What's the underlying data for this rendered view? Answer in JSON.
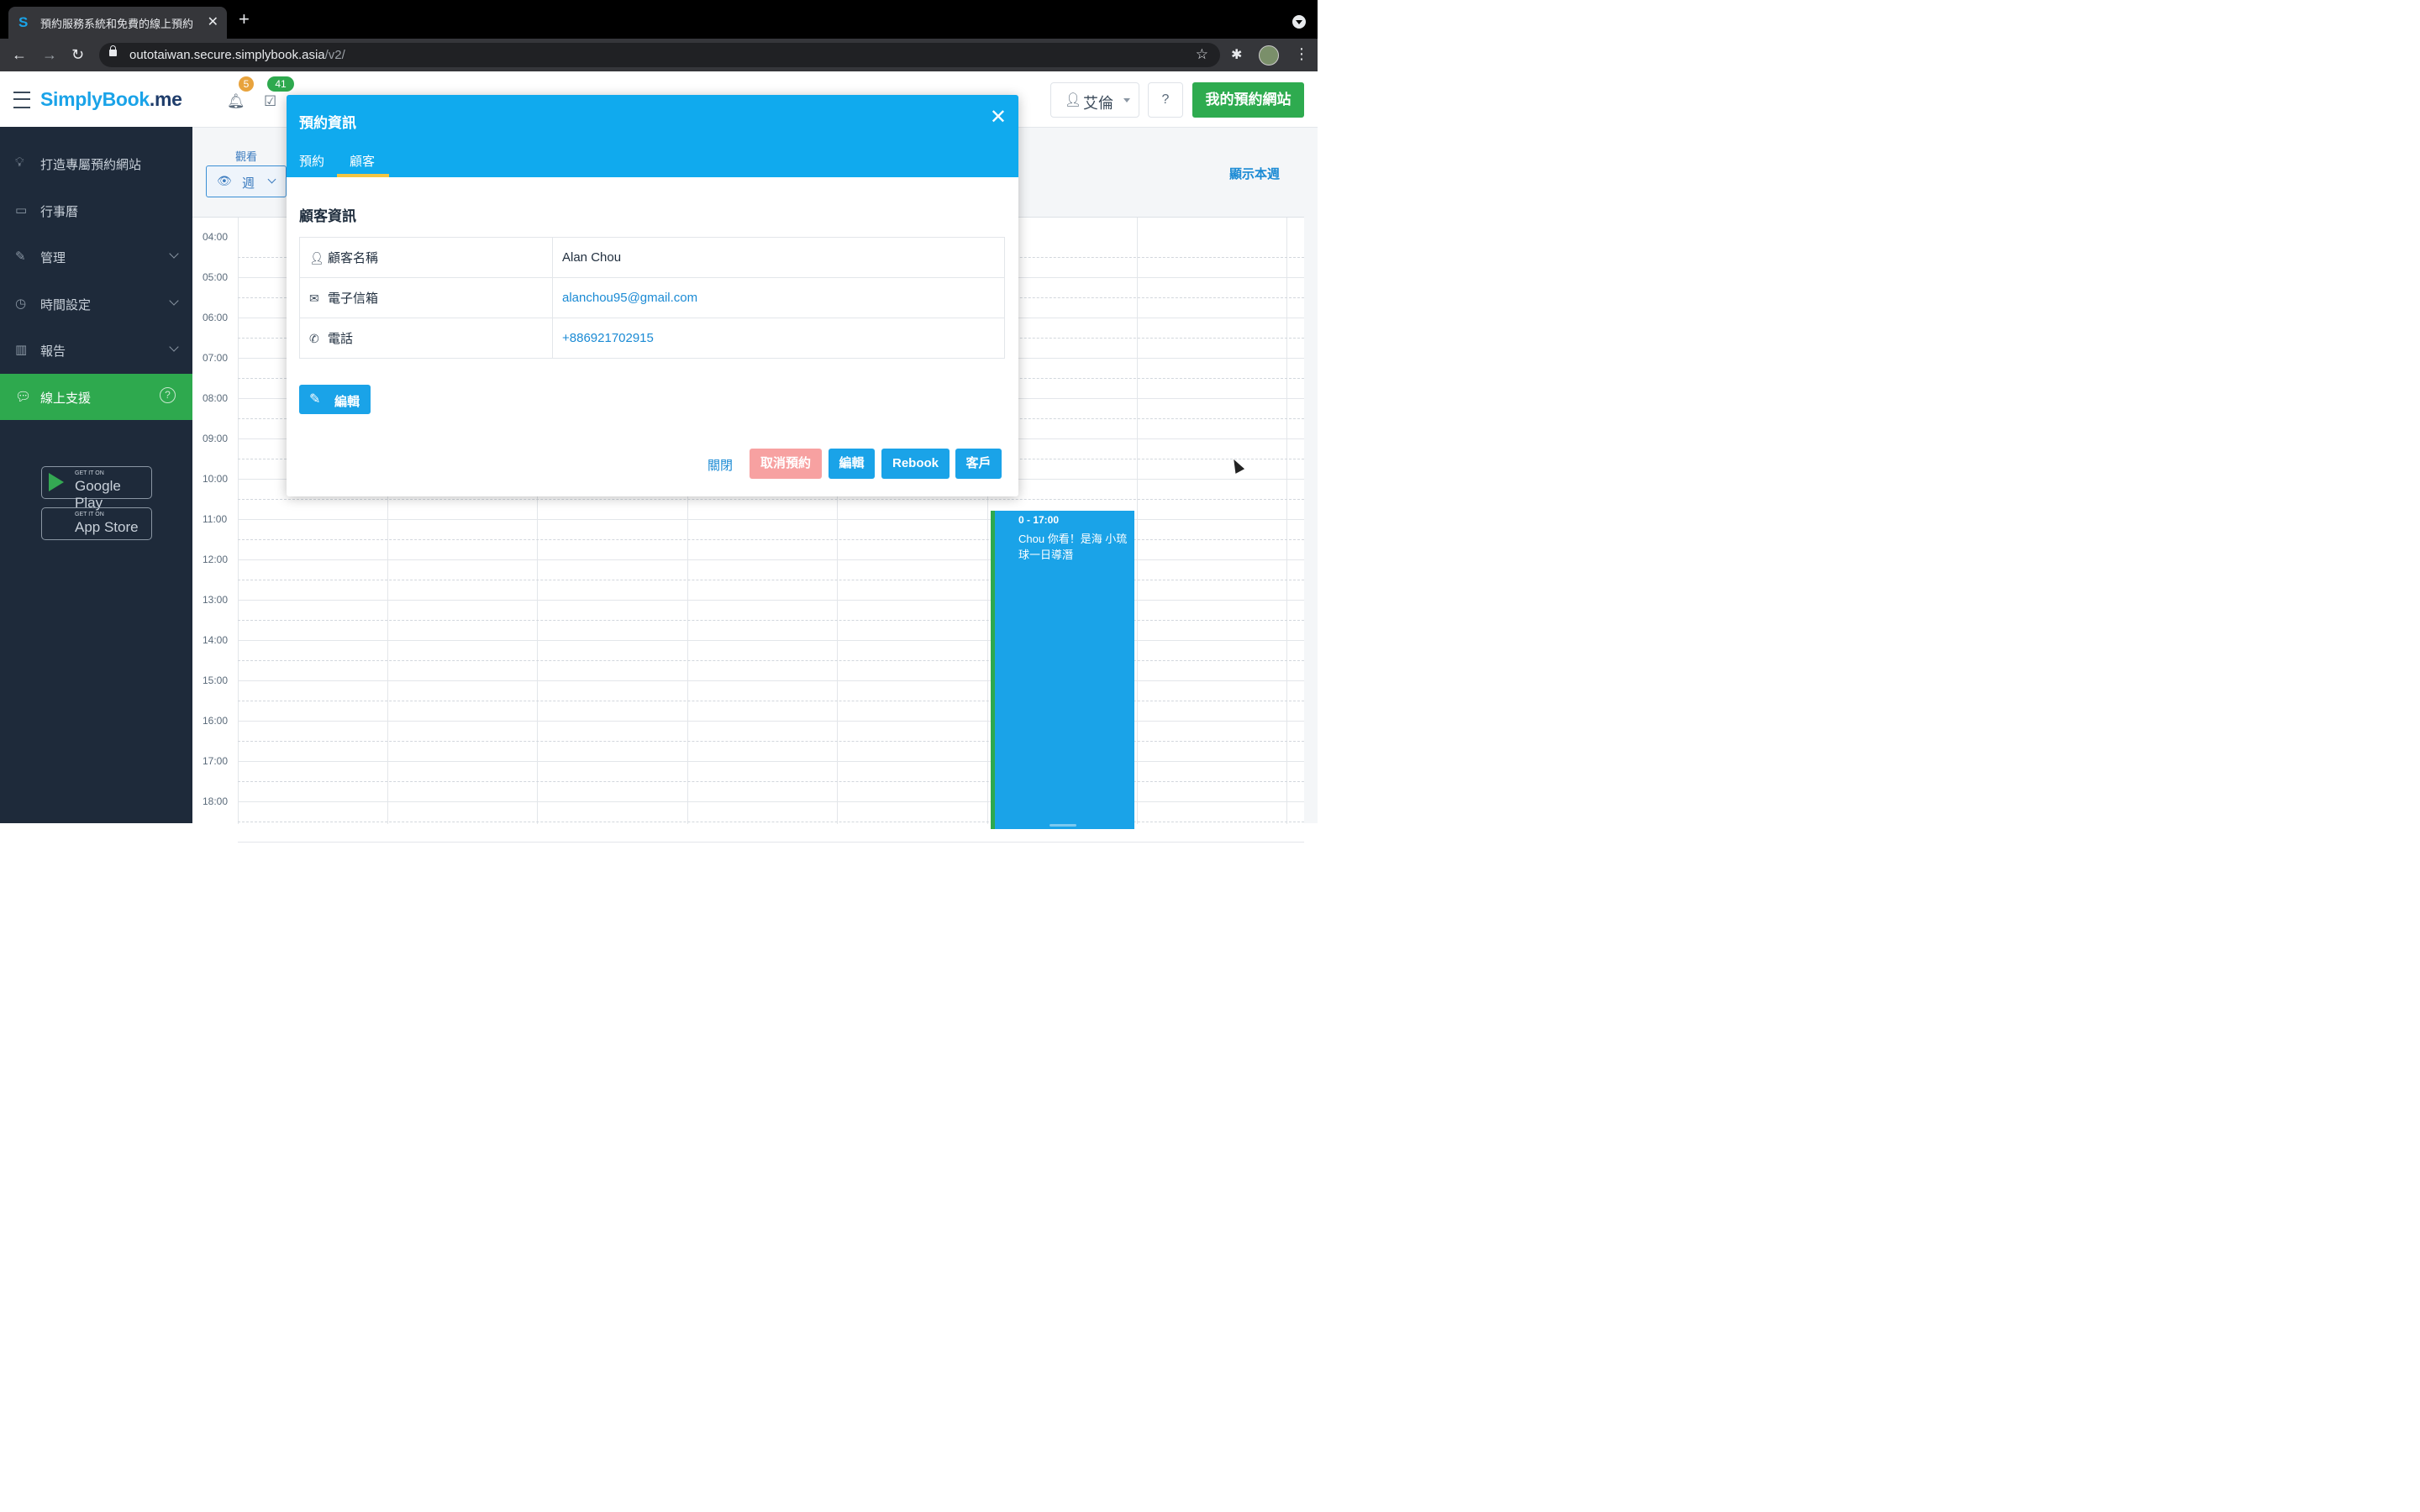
{
  "browser": {
    "tab_title": "預約服務系統和免費的線上預約",
    "url_host": "outotaiwan.secure.simplybook.asia",
    "url_path": "/v2/"
  },
  "header": {
    "logo_main": "SimplyBook",
    "logo_suffix": ".me",
    "notif_badge": "5",
    "tasks_badge": "41",
    "user_name": "艾倫",
    "site_button": "我的預約網站"
  },
  "sidebar": {
    "items": [
      {
        "label": "打造專屬預約網站",
        "icon": "lightbulb-icon"
      },
      {
        "label": "行事曆",
        "icon": "calendar-icon"
      },
      {
        "label": "管理",
        "icon": "pencil-icon"
      },
      {
        "label": "時間設定",
        "icon": "clock-icon"
      },
      {
        "label": "報告",
        "icon": "chart-icon"
      },
      {
        "label": "線上支援",
        "icon": "chat-icon"
      }
    ],
    "google_small": "GET IT ON",
    "google_big": "Google Play",
    "apple_small": "GET IT ON",
    "apple_big": "App Store"
  },
  "calendar": {
    "view_label": "觀看",
    "view_value": "週",
    "this_week": "顯示本週",
    "hours": [
      "04:00",
      "05:00",
      "06:00",
      "07:00",
      "08:00",
      "09:00",
      "10:00",
      "11:00",
      "12:00",
      "13:00",
      "14:00",
      "15:00",
      "16:00",
      "17:00",
      "18:00"
    ],
    "event_time": "0 - 17:00",
    "event_desc": "Chou 你看！是海 小琉球一日導潛"
  },
  "modal": {
    "title": "預約資訊",
    "tabs": [
      "預約",
      "顧客"
    ],
    "active_tab": "顧客",
    "section_title": "顧客資訊",
    "rows": [
      {
        "key": "顧客名稱",
        "value": "Alan Chou"
      },
      {
        "key": "電子信箱",
        "value": "alanchou95@gmail.com"
      },
      {
        "key": "電話",
        "value": "+886921702915"
      }
    ],
    "edit_label": "編輯",
    "footer": {
      "close": "關閉",
      "cancel": "取消預約",
      "edit": "編輯",
      "rebook": "Rebook",
      "client": "客戶"
    }
  },
  "colors": {
    "accent": "#10aaee",
    "green": "#2ea94e",
    "sidebar_bg": "#1e2a3a",
    "cancel": "#f7a1a1"
  }
}
